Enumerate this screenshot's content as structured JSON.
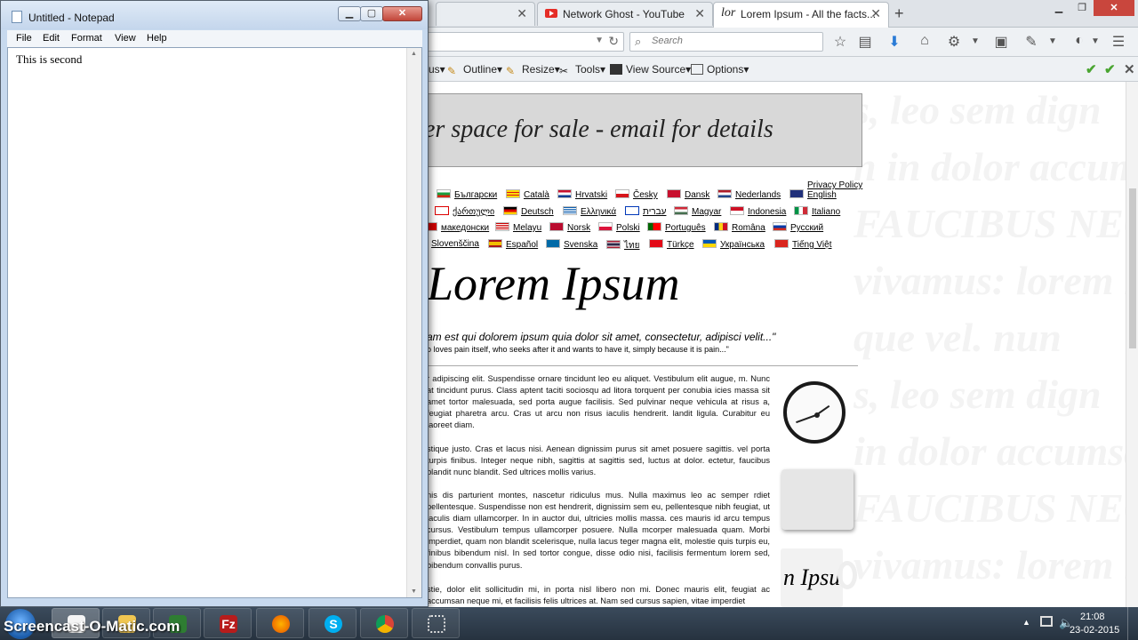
{
  "browser": {
    "tabs": [
      {
        "label": "",
        "active": false
      },
      {
        "label": "Network Ghost - YouTube",
        "icon": "youtube-icon",
        "active": false
      },
      {
        "label": "Lorem Ipsum - All the facts...",
        "icon": "lorem-favicon",
        "favicon_text": "lor",
        "active": true
      }
    ],
    "search_placeholder": "Search",
    "webdev_toolbar": {
      "items": [
        "Outline",
        "Resize",
        "Tools",
        "View Source",
        "Options"
      ]
    },
    "page": {
      "ad_banner": "er space for sale - email for details",
      "privacy_link": "Privacy Policy",
      "languages_row1": [
        "Български",
        "Català",
        "Hrvatski",
        "Česky",
        "Dansk",
        "Nederlands",
        "English"
      ],
      "languages_row2": [
        "ქართული",
        "Deutsch",
        "Ελληνικά",
        "עברית",
        "Magyar",
        "Indonesia",
        "Italiano"
      ],
      "languages_row3": [
        "македонски",
        "Melayu",
        "Norsk",
        "Polski",
        "Português",
        "Româna",
        "Русский"
      ],
      "languages_row4": [
        "Slovenščina",
        "Español",
        "Svenska",
        "ไทย",
        "Türkçe",
        "Українська",
        "Tiếng Việt"
      ],
      "title": "Lorem Ipsum",
      "quote": "am est qui dolorem ipsum quia dolor sit amet, consectetur, adipisci velit...\"",
      "quote_translation": "o loves pain itself, who seeks after it and wants to have it, simply because it is pain...\"",
      "paragraphs": [
        "r adipiscing elit. Suspendisse ornare tincidunt leo eu aliquet. Vestibulum elit augue, m. Nunc at tincidunt purus. Class aptent taciti sociosqu ad litora torquent per conubia icies massa sit amet tortor malesuada, sed porta augue facilisis. Sed pulvinar neque vehicula at risus a, feugiat pharetra arcu. Cras ut arcu non risus iaculis hendrerit. landit ligula. Curabitur eu laoreet diam.",
        "stique justo. Cras et lacus nisi. Aenean dignissim purus sit amet posuere sagittis. vel porta turpis finibus. Integer neque nibh, sagittis at sagittis sed, luctus at dolor. ectetur, faucibus blandit nunc blandit. Sed ultrices mollis varius.",
        "nis dis parturient montes, nascetur ridiculus mus. Nulla maximus leo ac semper rdiet pellentesque. Suspendisse non est hendrerit, dignissim sem eu, pellentesque nibh feugiat, ut iaculis diam ullamcorper. In in auctor dui, ultricies mollis massa. ces mauris id arcu tempus cursus. Vestibulum tempus ullamcorper posuere. Nulla mcorper malesuada quam. Morbi imperdiet, quam non blandit scelerisque, nulla lacus teger magna elit, molestie quis turpis eu, finibus bibendum nisl. In sed tortor congue, disse odio nisi, facilisis fermentum lorem sed, bibendum convallis purus.",
        "stie, dolor elit sollicitudin mi, in porta nisl libero non mi. Donec mauris elit, feugiat ac accumsan neque mi, et facilisis felis ultrices at. Nam sed cursus sapien, vitae imperdiet"
      ],
      "mug_text": "n Ipsu",
      "background_lines": [
        "s, leo sem dign",
        "n in dolor accumsan po",
        "FAUCIBUS NEC,",
        "vivamus: lorem ipsum dolor s",
        "que vel. nun",
        "s, leo sem dign",
        "in dolor accumsan p",
        "FAUCIBUS NEC,",
        "vivamus: lorem ipsum dolor s"
      ]
    }
  },
  "notepad": {
    "title": "Untitled - Notepad",
    "menu": [
      "File",
      "Edit",
      "Format",
      "View",
      "Help"
    ],
    "content": "This is second"
  },
  "taskbar": {
    "watermark": "Screencast-O-Matic.com",
    "time": "21:08",
    "date": "23-02-2015"
  }
}
